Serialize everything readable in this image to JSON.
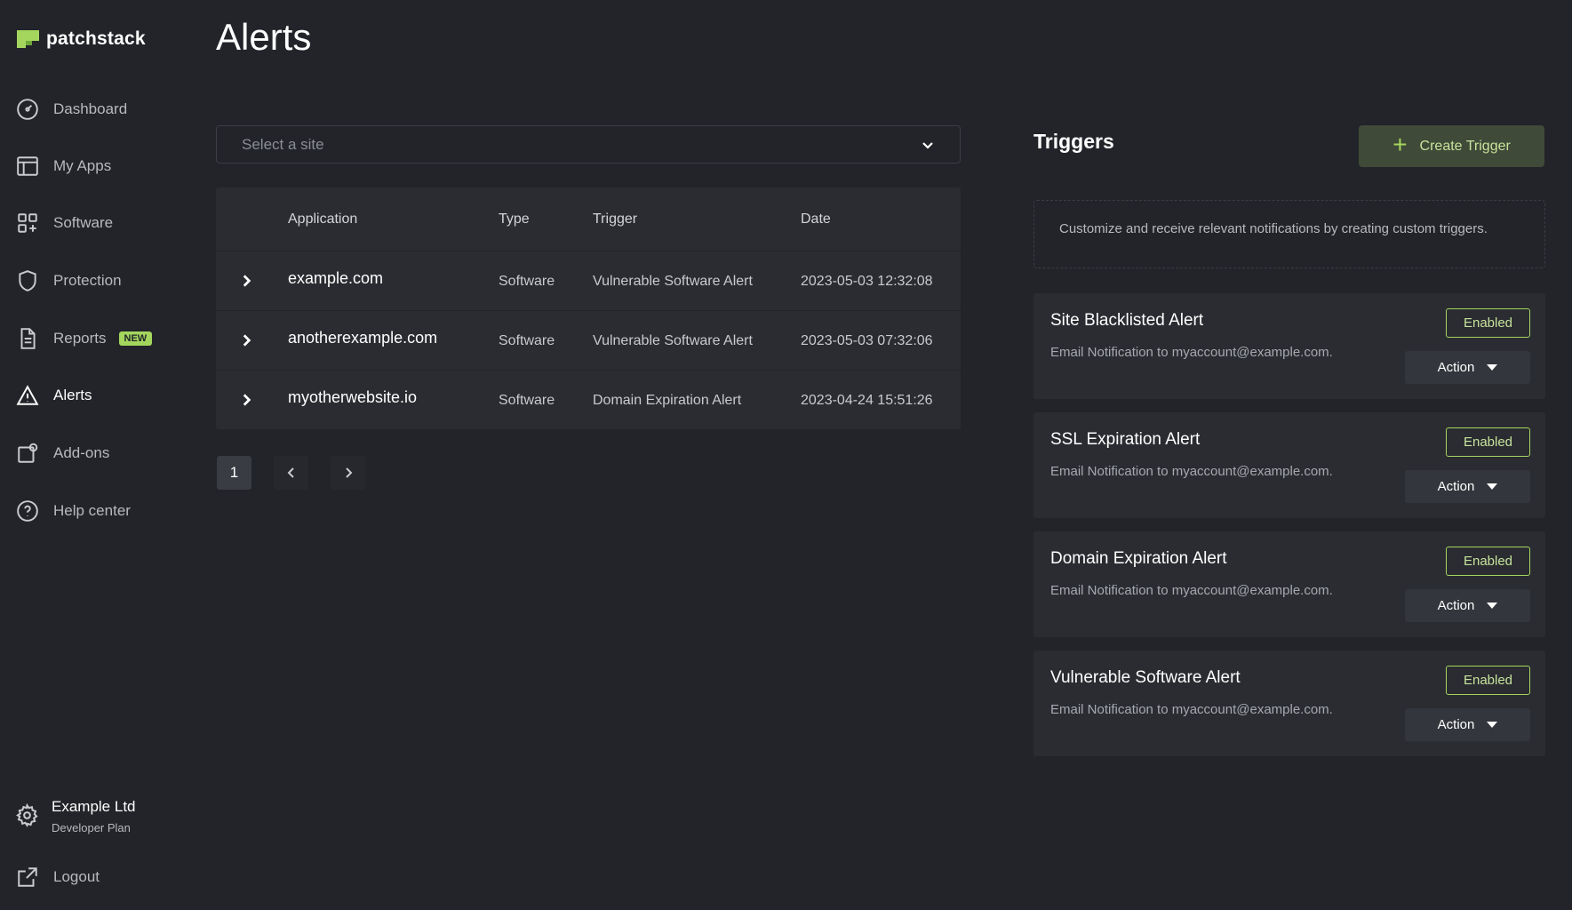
{
  "brand": {
    "name": "patchstack",
    "accent": "#a4d65e"
  },
  "sidebar": {
    "items": [
      {
        "label": "Dashboard",
        "icon": "dashboard-gauge-icon"
      },
      {
        "label": "My Apps",
        "icon": "apps-layout-icon"
      },
      {
        "label": "Software",
        "icon": "software-grid-icon"
      },
      {
        "label": "Protection",
        "icon": "shield-icon"
      },
      {
        "label": "Reports",
        "icon": "document-icon",
        "badge": "NEW"
      },
      {
        "label": "Alerts",
        "icon": "warning-triangle-icon",
        "active": true
      },
      {
        "label": "Add-ons",
        "icon": "addon-icon"
      },
      {
        "label": "Help center",
        "icon": "help-circle-icon"
      }
    ],
    "account": {
      "name": "Example Ltd",
      "plan": "Developer Plan",
      "icon": "gear-icon"
    },
    "logout": {
      "label": "Logout",
      "icon": "external-link-icon"
    }
  },
  "page": {
    "title": "Alerts"
  },
  "site_select": {
    "placeholder": "Select a site"
  },
  "table": {
    "headers": [
      "Application",
      "Type",
      "Trigger",
      "Date"
    ],
    "rows": [
      {
        "application": "example.com",
        "type": "Software",
        "trigger": "Vulnerable Software Alert",
        "date": "2023-05-03 12:32:08"
      },
      {
        "application": "anotherexample.com",
        "type": "Software",
        "trigger": "Vulnerable Software Alert",
        "date": "2023-05-03 07:32:06"
      },
      {
        "application": "myotherwebsite.io",
        "type": "Software",
        "trigger": "Domain Expiration Alert",
        "date": "2023-04-24 15:51:26"
      }
    ]
  },
  "pagination": {
    "current_page": "1"
  },
  "triggers": {
    "title": "Triggers",
    "create_button": "Create Trigger",
    "info": "Customize and receive relevant notifications by creating custom triggers.",
    "cards": [
      {
        "title": "Site Blacklisted Alert",
        "description": "Email Notification to myaccount@example.com.",
        "status": "Enabled",
        "action": "Action"
      },
      {
        "title": "SSL Expiration Alert",
        "description": "Email Notification to myaccount@example.com.",
        "status": "Enabled",
        "action": "Action"
      },
      {
        "title": "Domain Expiration Alert",
        "description": "Email Notification to myaccount@example.com.",
        "status": "Enabled",
        "action": "Action"
      },
      {
        "title": "Vulnerable Software Alert",
        "description": "Email Notification to myaccount@example.com.",
        "status": "Enabled",
        "action": "Action"
      }
    ]
  }
}
